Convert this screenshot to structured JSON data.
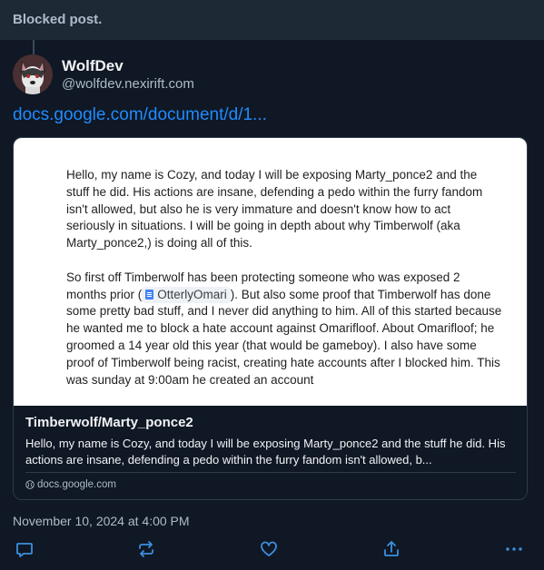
{
  "header": {
    "title": "Blocked post."
  },
  "author": {
    "name": "WolfDev",
    "handle": "@wolfdev.nexirift.com"
  },
  "post": {
    "link_text": "docs.google.com/document/d/1..."
  },
  "embed": {
    "preview": {
      "para1": "Hello, my name is Cozy, and today I will be exposing Marty_ponce2 and the stuff he did. His actions are insane, defending a pedo within the furry fandom isn't allowed, but also he is very immature and doesn't know how to act seriously in situations. I will be going in depth about why Timberwolf (aka Marty_ponce2,) is doing all of this.",
      "para2_before": "So first off Timberwolf has been protecting someone who was exposed 2 months prior (",
      "chip_label": "OtterlyOmari",
      "para2_after": "). But also some proof that Timberwolf has done some pretty bad stuff, and I never did anything to him. All of this started because he wanted me to block a hate account against Omarifloof. About Omarifloof; he groomed a 14 year old this year (that would be gameboy). I also have some proof of Timberwolf being racist, creating hate accounts after I blocked him. This was sunday at 9:00am he created an account"
    },
    "title": "Timberwolf/Marty_ponce2",
    "description": "Hello, my name is Cozy, and today I will be exposing Marty_ponce2 and the stuff he did. His actions are insane, defending a pedo within the furry fandom isn't allowed, b...",
    "domain": "docs.google.com"
  },
  "timestamp": "November 10, 2024 at 4:00 PM",
  "actions": {
    "reply_icon": "reply-icon",
    "repost_icon": "repost-icon",
    "like_icon": "heart-icon",
    "share_icon": "share-icon",
    "more_icon": "more-icon"
  },
  "colors": {
    "background": "#0f1824",
    "header_bg": "#1e2936",
    "link": "#208bfe",
    "muted_text": "#aebbc9",
    "action_icon": "#3d8fe0"
  }
}
